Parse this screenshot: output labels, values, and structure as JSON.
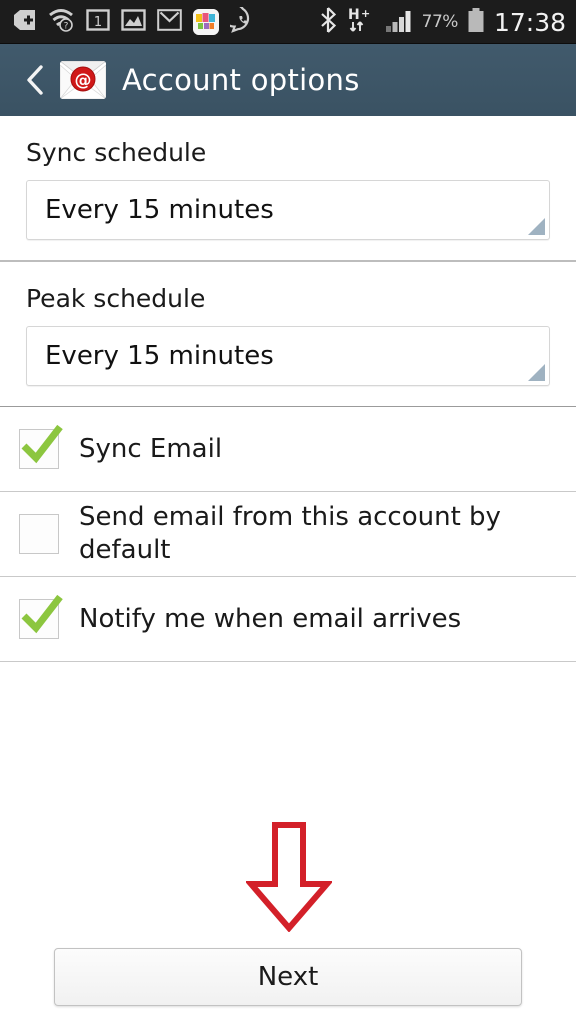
{
  "status_bar": {
    "left_icons": [
      {
        "name": "plus-tag-icon",
        "label": "+"
      },
      {
        "name": "wifi-question-icon",
        "label": "wifi"
      },
      {
        "name": "calendar-one-icon",
        "label": "1"
      },
      {
        "name": "image-gallery-icon",
        "label": "gallery"
      },
      {
        "name": "gmail-icon",
        "label": "M"
      },
      {
        "name": "yada-app-icon",
        "label": "yada"
      },
      {
        "name": "whatsapp-icon",
        "label": "whatsapp"
      }
    ],
    "right_icons": [
      {
        "name": "bluetooth-icon",
        "label": "bluetooth"
      },
      {
        "name": "hspa-plus-icon",
        "label": "H+"
      },
      {
        "name": "signal-bars-icon",
        "label": "signal"
      }
    ],
    "battery_percent": "77%",
    "battery_icon": "battery-icon",
    "clock": "17:38"
  },
  "header": {
    "back_icon": "back-chevron-icon",
    "app_icon": "email-at-envelope-icon",
    "title": "Account options",
    "background_color": "#3C5465"
  },
  "settings": {
    "sync_schedule": {
      "label": "Sync schedule",
      "value": "Every 15 minutes",
      "dropdown_icon": "spinner-triangle-icon"
    },
    "peak_schedule": {
      "label": "Peak schedule",
      "value": "Every 15 minutes",
      "dropdown_icon": "spinner-triangle-icon"
    },
    "checkboxes": [
      {
        "label": "Sync Email",
        "checked": true,
        "icon": "checkmark-icon"
      },
      {
        "label": "Send email from this account by default",
        "checked": false,
        "icon": "empty-checkbox-icon"
      },
      {
        "label": "Notify me when email arrives",
        "checked": true,
        "icon": "checkmark-icon"
      }
    ]
  },
  "annotation": {
    "arrow_icon": "red-down-arrow-annotation",
    "color": "#D32029"
  },
  "footer": {
    "next_label": "Next"
  },
  "colors": {
    "check_green": "#8CC63F",
    "spinner_triangle": "#9FB2C1",
    "status_bar_bg": "#1C1C1C",
    "header_bg": "#3C5465",
    "annotation_red": "#D32029"
  }
}
